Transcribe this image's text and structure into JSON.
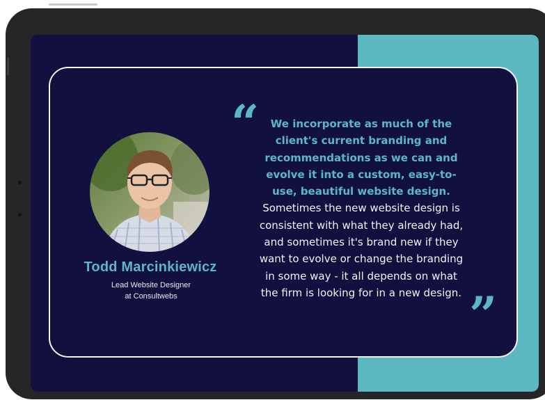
{
  "testimonial": {
    "name": "Todd Marcinkiewicz",
    "role_line1": "Lead Website Designer",
    "role_line2": "at Consultwebs",
    "quote_open": "“",
    "quote_close": "”",
    "quote_bold": "We incorporate as much of the client's current branding and recommendations as we can and evolve it into a custom, easy-to-use, beautiful website design.",
    "quote_regular": "Sometimes the new website design is consistent with what they already had, and sometimes it's brand new if they want to evolve or change the branding in some way - it all depends on what the firm is looking for in a new design."
  },
  "colors": {
    "navy": "#11103f",
    "teal": "#5bb8c0",
    "bezel": "#262628",
    "border": "#f4f4f8"
  }
}
